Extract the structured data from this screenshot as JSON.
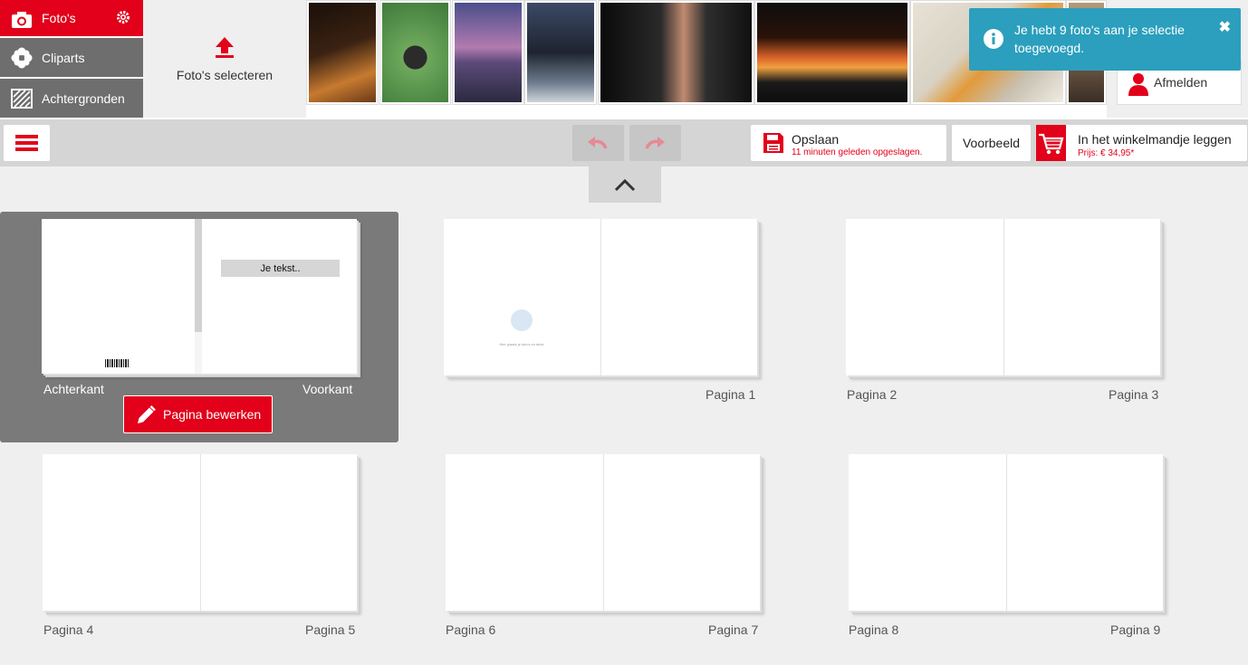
{
  "media_tabs": [
    {
      "label": "Foto's",
      "icon": "camera-icon"
    },
    {
      "label": "Cliparts",
      "icon": "flower-icon"
    },
    {
      "label": "Achtergronden",
      "icon": "background-icon"
    }
  ],
  "upload": {
    "label": "Foto's selecteren",
    "icon": "upload-arrow-icon"
  },
  "photos": [
    {
      "subject": "candles on table",
      "colors": [
        "#2b1a10",
        "#c77a30"
      ]
    },
    {
      "subject": "grill on lawn",
      "colors": [
        "#3e7a3a",
        "#6ea85c"
      ]
    },
    {
      "subject": "lakeside at dusk",
      "colors": [
        "#5c4a7a",
        "#b27bb0"
      ]
    },
    {
      "subject": "dinner table at night",
      "colors": [
        "#1e2430",
        "#6c7a8c"
      ]
    },
    {
      "subject": "businessman handshake",
      "colors": [
        "#111111",
        "#4a4a4a"
      ]
    },
    {
      "subject": "fire pit",
      "colors": [
        "#0d0d0d",
        "#d9622a"
      ]
    },
    {
      "subject": "worker with tools",
      "colors": [
        "#d8d2c4",
        "#e29a3a"
      ]
    },
    {
      "subject": "partial photo",
      "colors": [
        "#6e5a48",
        "#b59a7a"
      ]
    }
  ],
  "account": {
    "logout_label": "Afmelden"
  },
  "notification": {
    "message": "Je hebt 9 foto's aan je selectie toegevoegd."
  },
  "toolbar": {
    "save_label": "Opslaan",
    "save_status": "11 minuten geleden opgeslagen.",
    "preview_label": "Voorbeeld",
    "cart_label": "In het winkelmandje leggen",
    "price": "Prijs: € 34,95*"
  },
  "cover": {
    "back_label": "Achterkant",
    "front_label": "Voorkant",
    "text_placeholder": "Je tekst..",
    "edit_button": "Pagina bewerken"
  },
  "empty_hint": "Hier plaats je foto's en tekst",
  "spreads": [
    {
      "left": "",
      "right": "Pagina 1"
    },
    {
      "left": "Pagina 2",
      "right": "Pagina 3"
    },
    {
      "left": "Pagina 4",
      "right": "Pagina 5"
    },
    {
      "left": "Pagina 6",
      "right": "Pagina 7"
    },
    {
      "left": "Pagina 8",
      "right": "Pagina 9"
    }
  ],
  "colors": {
    "brand": "#e2001a",
    "notification": "#2b9fbd",
    "toolbar": "#d5d5d5",
    "panel": "#7a7a7a"
  }
}
